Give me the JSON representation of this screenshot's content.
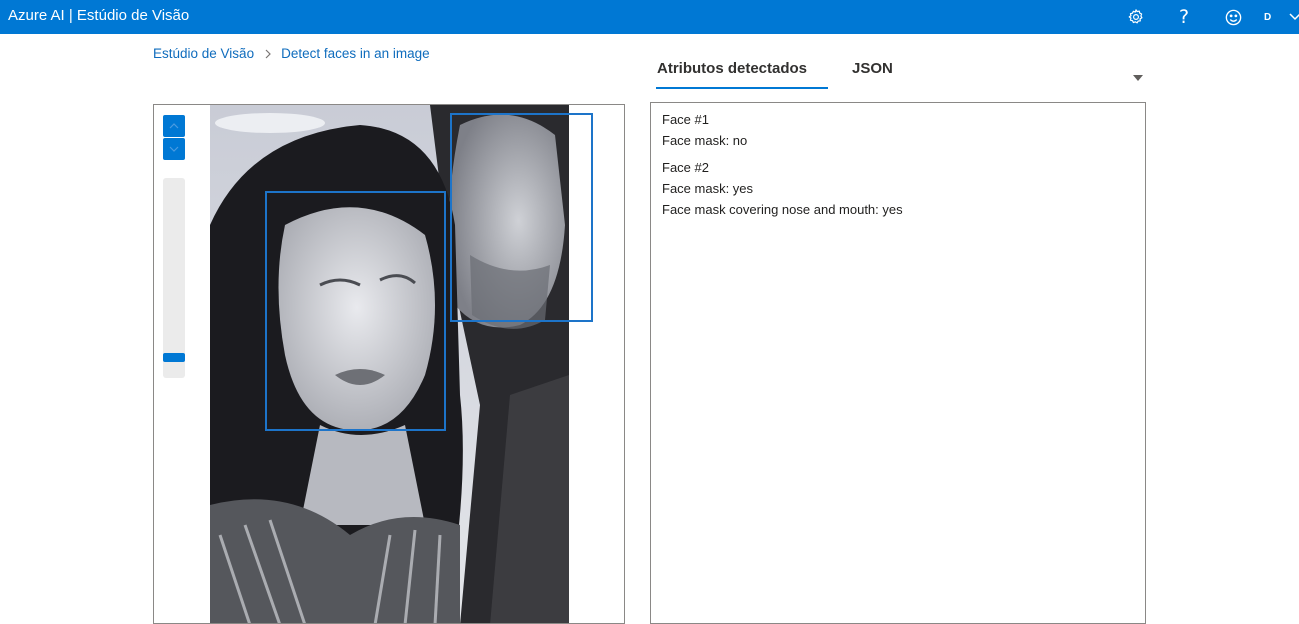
{
  "app": {
    "title": "Azure AI | Estúdio de Visão"
  },
  "topbar": {
    "icons": [
      "gear-icon",
      "help-icon",
      "smiley-icon"
    ],
    "help_glyph": "?",
    "account_initial": "D"
  },
  "breadcrumb": {
    "root": "Estúdio de Visão",
    "current": "Detect faces in an image"
  },
  "viewer": {
    "zoom_level_fraction": 0.05,
    "faces_drawn": [
      "face-1",
      "face-2"
    ]
  },
  "tabs": [
    {
      "label": "Atributos detectados",
      "selected": true
    },
    {
      "label": "JSON",
      "selected": false
    }
  ],
  "results": {
    "faces": [
      {
        "title": "Face #1",
        "lines": [
          "Face mask: no"
        ]
      },
      {
        "title": "Face #2",
        "lines": [
          "Face mask: yes",
          "Face mask covering nose and mouth: yes"
        ]
      }
    ]
  },
  "colors": {
    "accent": "#0078d4",
    "link": "#0f6cbd",
    "face_box": "#1d74c9"
  }
}
